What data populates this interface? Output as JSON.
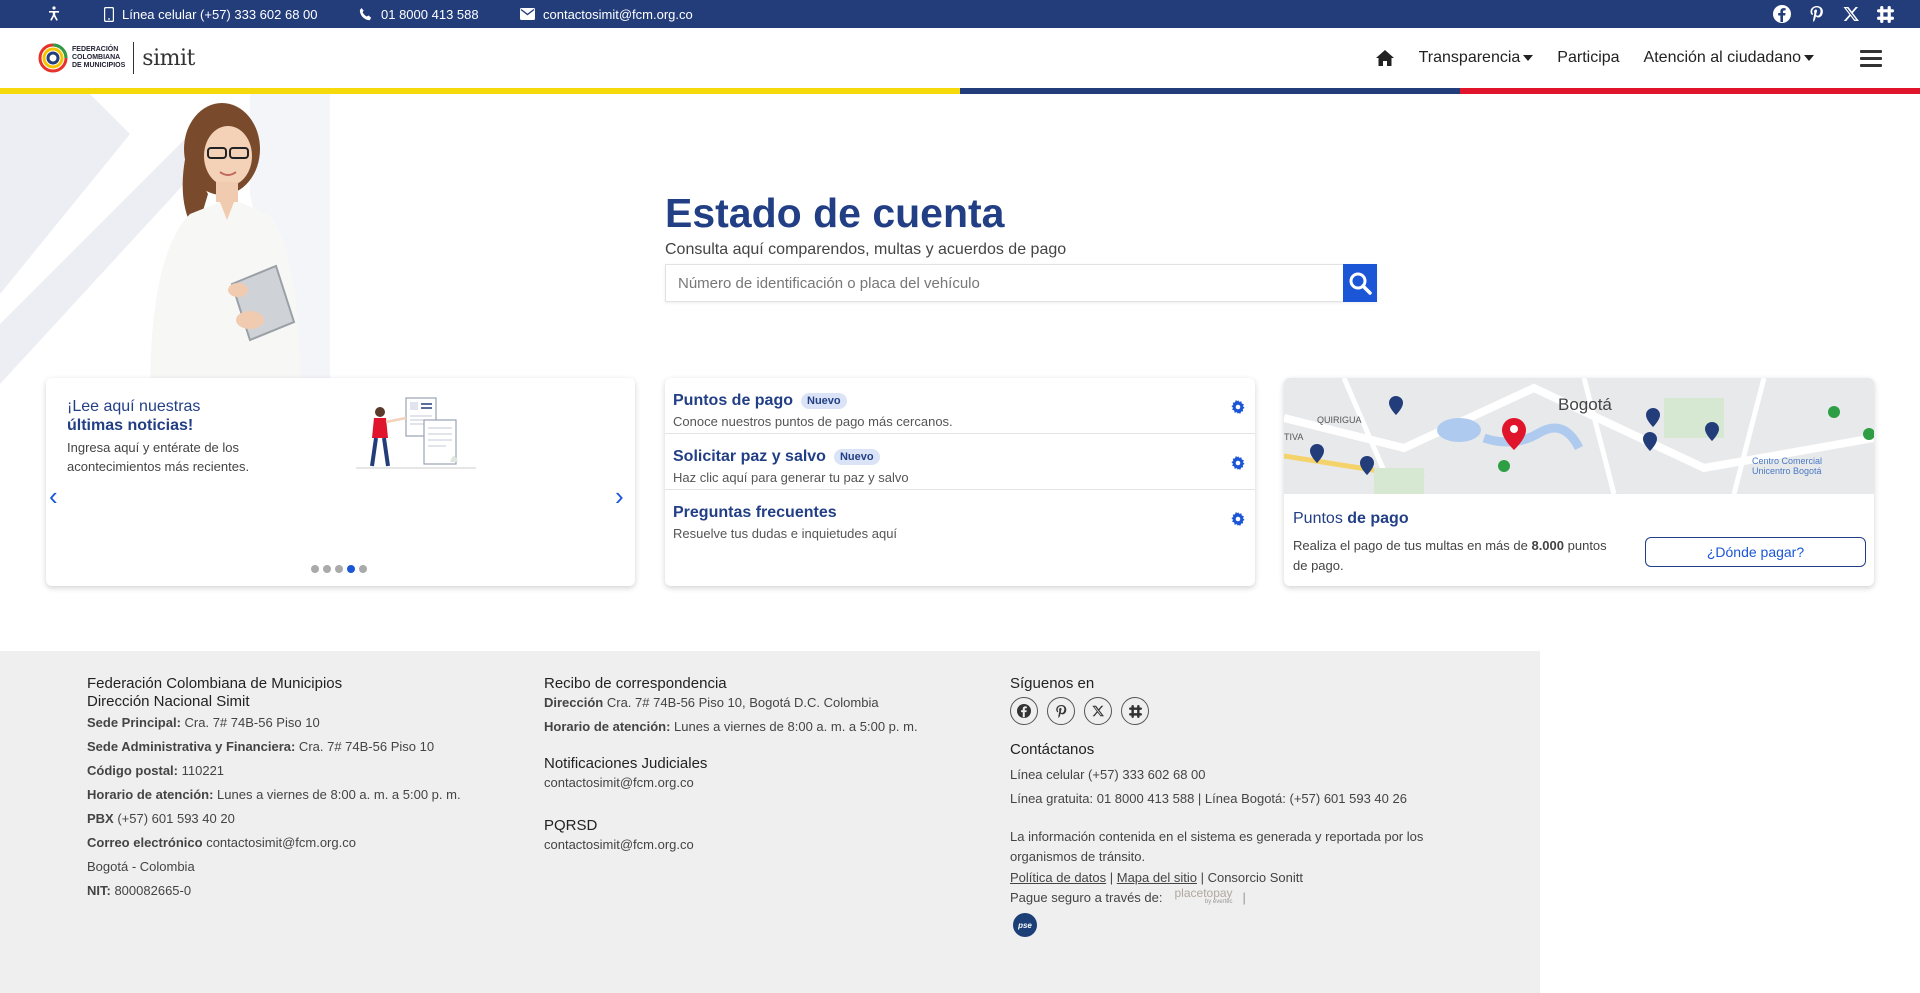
{
  "topbar": {
    "cell": "Línea celular (+57) 333 602 68 00",
    "phone": "01 8000 413 588",
    "email": "contactosimit@fcm.org.co"
  },
  "header": {
    "logo_line1": "FEDERACIÓN",
    "logo_line2": "COLOMBIANA",
    "logo_line3": "DE MUNICIPIOS",
    "logo_simit": "simit",
    "nav": {
      "transparencia": "Transparencia",
      "participa": "Participa",
      "atencion": "Atención al ciudadano"
    }
  },
  "hero": {
    "title": "Estado de cuenta",
    "subtitle": "Consulta aquí comparendos, multas y acuerdos de pago",
    "search_placeholder": "Número de identificación o placa del vehículo"
  },
  "news": {
    "line1": "¡Lee aquí nuestras",
    "line2": "últimas noticias!",
    "desc": "Ingresa aquí y entérate de los acontecimientos más recientes.",
    "active_slide": 4,
    "slide_count": 5
  },
  "links": [
    {
      "title": "Puntos de pago",
      "badge": "Nuevo",
      "desc": "Conoce nuestros puntos de pago más cercanos."
    },
    {
      "title": "Solicitar paz y salvo",
      "badge": "Nuevo",
      "desc": "Haz clic aquí para generar tu paz y salvo"
    },
    {
      "title": "Preguntas frecuentes",
      "badge": "",
      "desc": "Resuelve tus dudas e inquietudes aquí"
    }
  ],
  "map_card": {
    "map_city": "Bogotá",
    "map_label1": "QUIRIGUA",
    "map_label2": "TIVA",
    "map_label3": "Centro Comercial",
    "map_label4": "Unicentro Bogotá",
    "title_plain": "Puntos ",
    "title_bold": "de pago",
    "desc_pre": "Realiza el pago de tus multas en más de ",
    "desc_bold": "8.000",
    "desc_post": " puntos de pago.",
    "button": "¿Dónde pagar?"
  },
  "footer": {
    "col1": {
      "h1": "Federación Colombiana de Municipios",
      "h2": "Dirección Nacional Simit",
      "sede_label": "Sede Principal:",
      "sede": " Cra. 7# 74B-56 Piso 10",
      "sede_adm_label": "Sede Administrativa y Financiera:",
      "sede_adm": " Cra. 7# 74B-56 Piso 10",
      "cp_label": "Código postal:",
      "cp": " 110221",
      "horario_label": "Horario de atención:",
      "horario": " Lunes a viernes de 8:00 a. m. a 5:00 p. m.",
      "pbx_label": "PBX",
      "pbx": " (+57) 601 593 40 20",
      "correo_label": "Correo electrónico",
      "correo": " contactosimit@fcm.org.co",
      "ciudad": "Bogotá - Colombia",
      "nit_label": "NIT:",
      "nit": " 800082665-0"
    },
    "col2": {
      "h1": "Recibo de correspondencia",
      "dir_label": "Dirección",
      "dir": " Cra. 7# 74B-56 Piso 10, Bogotá D.C. Colombia",
      "horario_label": "Horario de atención:",
      "horario": " Lunes a viernes de 8:00 a. m. a 5:00 p. m.",
      "h2": "Notificaciones Judiciales",
      "email2": "contactosimit@fcm.org.co",
      "h3": "PQRSD",
      "email3": "contactosimit@fcm.org.co"
    },
    "col3": {
      "h1": "Síguenos en",
      "h2": "Contáctanos",
      "cel": "Línea celular (+57) 333 602 68 00",
      "gratuita": "Línea gratuita: 01 8000 413 588 | Línea Bogotá: (+57) 601 593 40 26",
      "info": "La información contenida en el sistema es generada y reportada por los organismos de tránsito.",
      "politica": "Política de datos",
      "mapa": "Mapa del sitio",
      "consorcio": " | Consorcio Sonitt",
      "pague": "Pague seguro a través de:",
      "placetopay": "placetopay",
      "evertec": "by evertec",
      "pse": "pse"
    }
  }
}
